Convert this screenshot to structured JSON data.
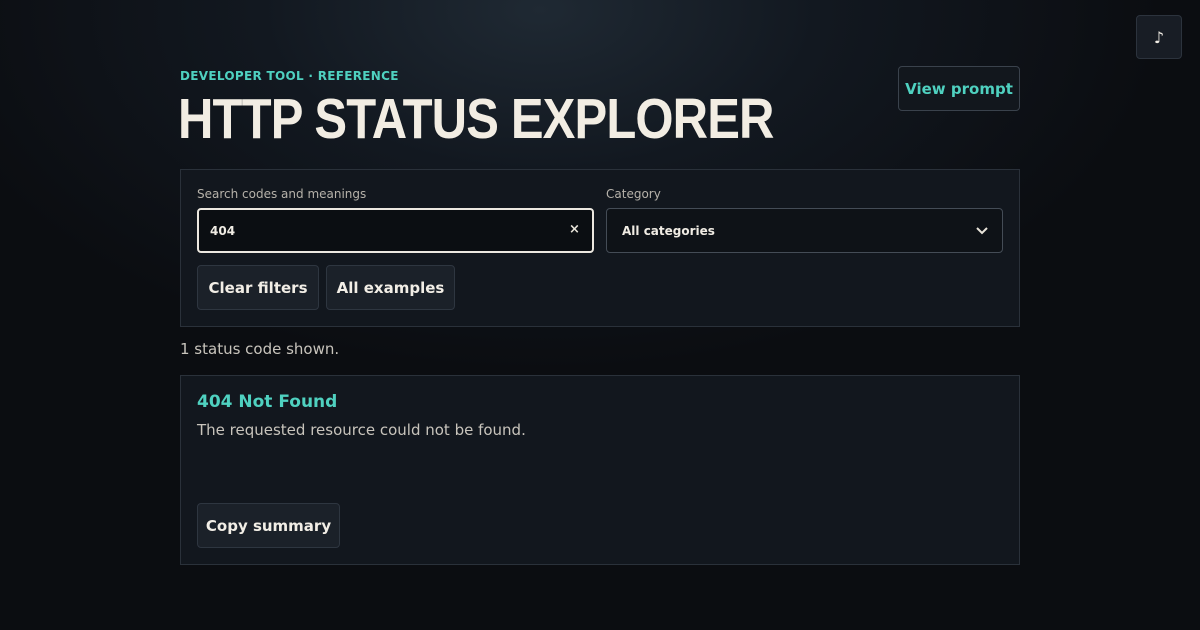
{
  "music_button": {
    "icon": "music-note-icon",
    "glyph": "♪"
  },
  "header": {
    "eyebrow": "DEVELOPER TOOL · REFERENCE",
    "title": "HTTP STATUS EXPLORER",
    "view_prompt_label": "View prompt"
  },
  "filters": {
    "search_label": "Search codes and meanings",
    "search_value": "404",
    "clear_glyph": "×",
    "category_label": "Category",
    "category_selected": "All categories",
    "clear_filters_label": "Clear filters",
    "all_examples_label": "All examples"
  },
  "results": {
    "count_text": "1 status code shown.",
    "items": [
      {
        "title": "404 Not Found",
        "description": "The requested resource could not be found.",
        "copy_label": "Copy summary"
      }
    ]
  },
  "colors": {
    "accent": "#4fd1c0",
    "background": "#0b0d11",
    "panel": "#12171e",
    "text": "#f2ede3"
  }
}
